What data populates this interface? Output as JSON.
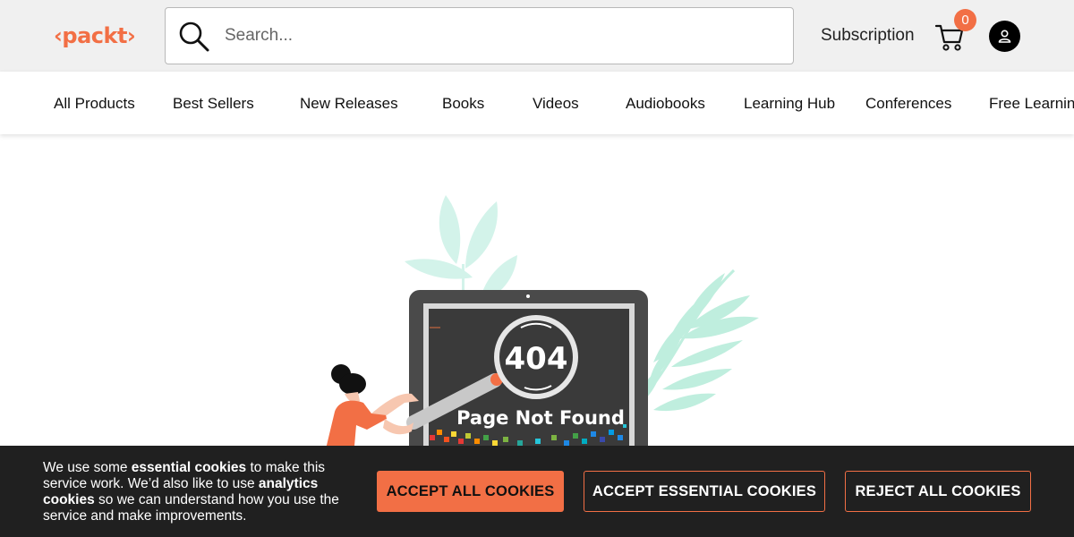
{
  "header": {
    "logo_text": "‹packt›",
    "search_placeholder": "Search...",
    "subscription_label": "Subscription",
    "cart_count": "0",
    "brand_color": "#f26f45"
  },
  "nav": {
    "items": [
      "All Products",
      "Best Sellers",
      "New Releases",
      "Books",
      "Videos",
      "Audiobooks",
      "Learning Hub",
      "Conferences",
      "Free Learning"
    ]
  },
  "error_page": {
    "code": "404",
    "message": "Page Not Found"
  },
  "cookie_banner": {
    "text_parts": {
      "p1": "We use some ",
      "b1": "essential cookies",
      "p2": " to make this service work. We’d also like to use ",
      "b2": "analytics cookies",
      "p3": " so we can understand how you use the service and make improvements."
    },
    "accept_all_label": "ACCEPT ALL COOKIES",
    "accept_essential_label": "ACCEPT ESSENTIAL COOKIES",
    "reject_all_label": "REJECT ALL COOKIES"
  },
  "icons": {
    "search": "search-icon",
    "cart": "cart-icon",
    "account": "user-icon"
  }
}
